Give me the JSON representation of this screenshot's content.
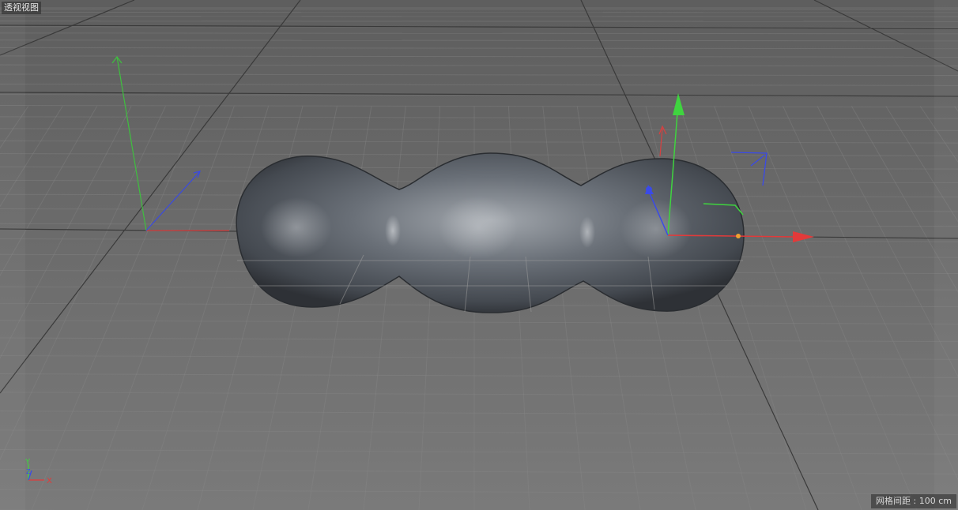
{
  "viewport": {
    "label": "透视视图",
    "grid_spacing_text": "网格间距 : 100 cm"
  },
  "axis_indicator": {
    "y_label": "Y",
    "x_label": "X",
    "z_label": "Z"
  },
  "colors": {
    "axis_x": "#e23a3a",
    "axis_y": "#3fd43f",
    "axis_z": "#3a4ae8",
    "object": "#5a5f66",
    "handle_point": "#f0a030"
  },
  "scene_object": {
    "name": "metaball-object"
  }
}
